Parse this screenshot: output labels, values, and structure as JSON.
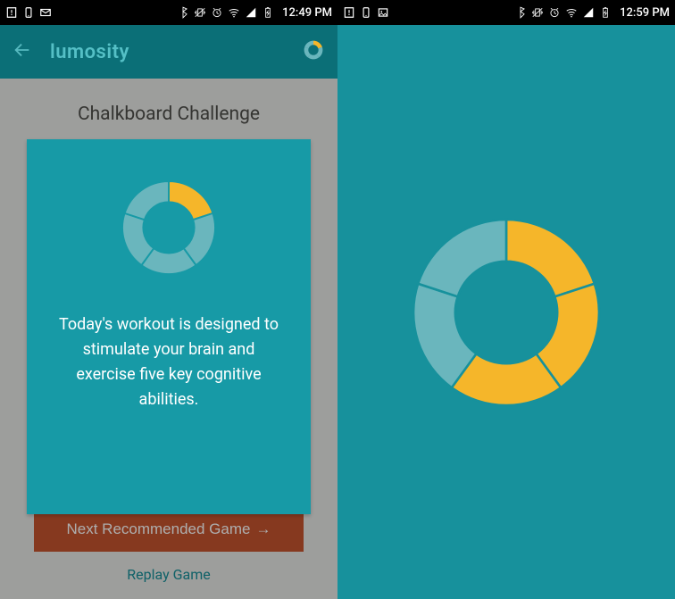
{
  "left": {
    "status": {
      "time": "12:49 PM"
    },
    "toolbar": {
      "title": "lumosity"
    },
    "heading": "Chalkboard Challenge",
    "modal": {
      "body": "Today's workout is designed to stimulate your brain and exercise five key cognitive abilities."
    },
    "buttons": {
      "primary": "Next Recommended Game",
      "primary_arrow": "→",
      "replay": "Replay Game"
    },
    "donut_segments_filled": 1
  },
  "right": {
    "status": {
      "time": "12:59 PM"
    },
    "donut_segments_filled": 3
  },
  "colors": {
    "teal_bg": "#17919c",
    "card_bg": "#179aa6",
    "segment_off": "#6ab6bd",
    "segment_on": "#f5b62a",
    "toolbar": "#0b6f77",
    "primary_btn": "#c6542e"
  }
}
